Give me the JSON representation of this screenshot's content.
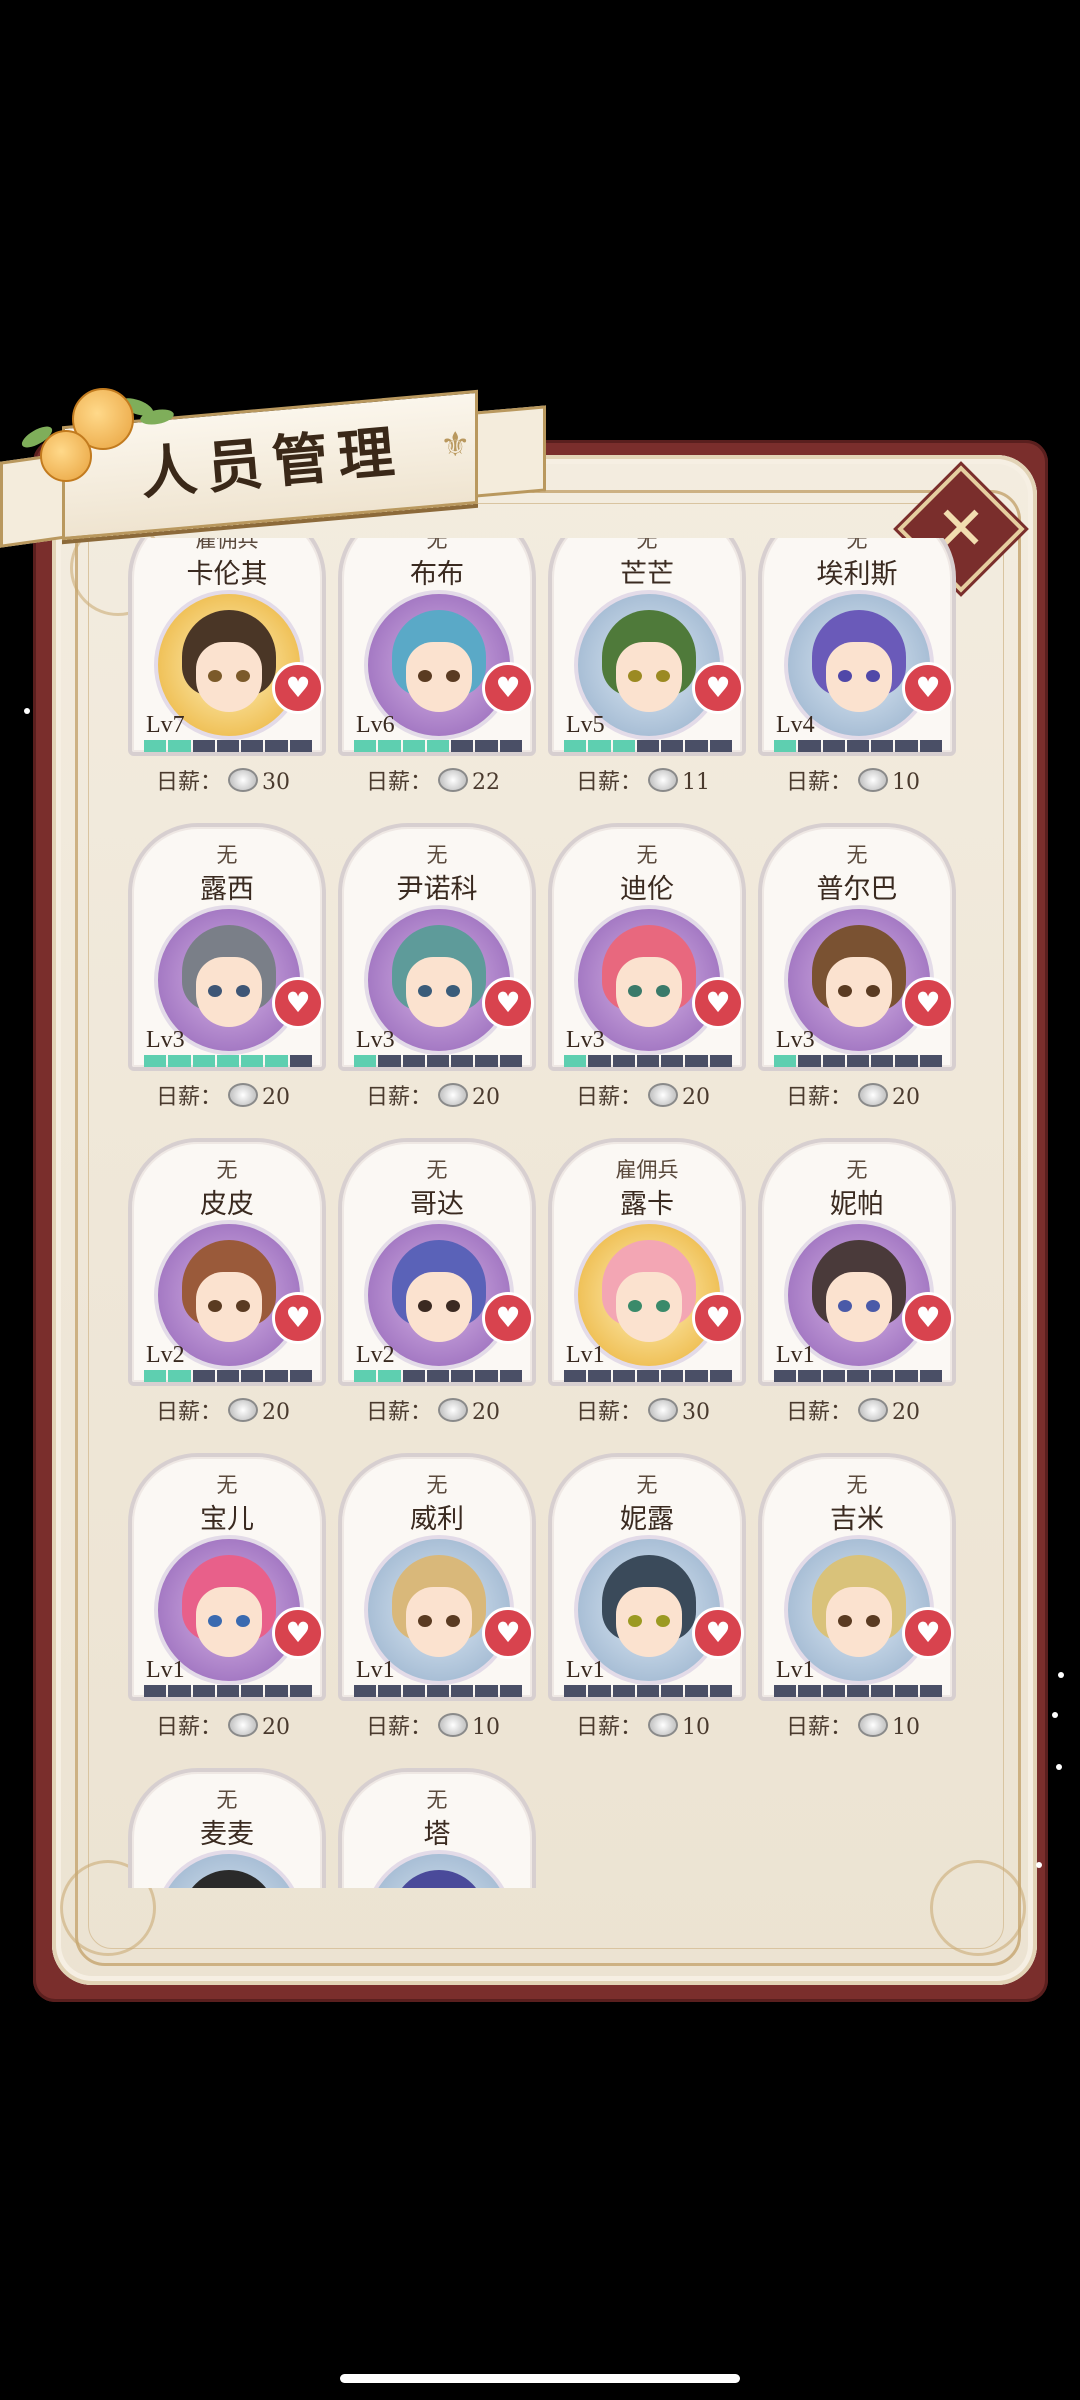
{
  "title": "人员管理",
  "salary_label": "日薪：",
  "colors": {
    "frame": "#7a2e2c",
    "heart": "#d8434e",
    "exp_bar": "#5ecfb0"
  },
  "staff": [
    {
      "role": "雇佣兵",
      "name": "卡伦其",
      "level": "Lv7",
      "exp": 2,
      "salary": "30",
      "bg": "gold",
      "hair": "#4a3626",
      "eye": "#7b5a2a"
    },
    {
      "role": "无",
      "name": "布布",
      "level": "Lv6",
      "exp": 4,
      "salary": "22",
      "bg": "purple",
      "hair": "#5aa9c7",
      "eye": "#5a3b22"
    },
    {
      "role": "无",
      "name": "芒芒",
      "level": "Lv5",
      "exp": 3,
      "salary": "11",
      "bg": "blue",
      "hair": "#4f7a3a",
      "eye": "#9b8a22"
    },
    {
      "role": "无",
      "name": "埃利斯",
      "level": "Lv4",
      "exp": 1,
      "salary": "10",
      "bg": "blue",
      "hair": "#6a5ab9",
      "eye": "#5048a8"
    },
    {
      "role": "无",
      "name": "露西",
      "level": "Lv3",
      "exp": 6,
      "salary": "20",
      "bg": "purple",
      "hair": "#7a7f88",
      "eye": "#3e5676"
    },
    {
      "role": "无",
      "name": "尹诺科",
      "level": "Lv3",
      "exp": 1,
      "salary": "20",
      "bg": "purple",
      "hair": "#5e9b9a",
      "eye": "#3a5c7a"
    },
    {
      "role": "无",
      "name": "迪伦",
      "level": "Lv3",
      "exp": 1,
      "salary": "20",
      "bg": "purple",
      "hair": "#e8687e",
      "eye": "#3a7a6a"
    },
    {
      "role": "无",
      "name": "普尔巴",
      "level": "Lv3",
      "exp": 1,
      "salary": "20",
      "bg": "purple",
      "hair": "#7a5232",
      "eye": "#5a3b22"
    },
    {
      "role": "无",
      "name": "皮皮",
      "level": "Lv2",
      "exp": 2,
      "salary": "20",
      "bg": "purple",
      "hair": "#9a5a3a",
      "eye": "#5a3b22"
    },
    {
      "role": "无",
      "name": "哥达",
      "level": "Lv2",
      "exp": 2,
      "salary": "20",
      "bg": "purple",
      "hair": "#5a62b8",
      "eye": "#3b2a22"
    },
    {
      "role": "雇佣兵",
      "name": "露卡",
      "level": "Lv1",
      "exp": 0,
      "salary": "30",
      "bg": "gold",
      "hair": "#f3a6b4",
      "eye": "#3a8a6a"
    },
    {
      "role": "无",
      "name": "妮帕",
      "level": "Lv1",
      "exp": 0,
      "salary": "20",
      "bg": "purple",
      "hair": "#4a3a3a",
      "eye": "#4a5aa8"
    },
    {
      "role": "无",
      "name": "宝儿",
      "level": "Lv1",
      "exp": 0,
      "salary": "20",
      "bg": "purple",
      "hair": "#e8608a",
      "eye": "#3a6ab0"
    },
    {
      "role": "无",
      "name": "威利",
      "level": "Lv1",
      "exp": 0,
      "salary": "10",
      "bg": "blue",
      "hair": "#d9b87a",
      "eye": "#5a3b22"
    },
    {
      "role": "无",
      "name": "妮露",
      "level": "Lv1",
      "exp": 0,
      "salary": "10",
      "bg": "blue",
      "hair": "#3a4a5a",
      "eye": "#9b9a22"
    },
    {
      "role": "无",
      "name": "吉米",
      "level": "Lv1",
      "exp": 0,
      "salary": "10",
      "bg": "blue",
      "hair": "#d9c27a",
      "eye": "#5a3b22"
    },
    {
      "role": "无",
      "name": "麦麦",
      "level": "",
      "exp": 0,
      "salary": "",
      "bg": "blue",
      "hair": "#2a2a2a",
      "eye": "#3a3a3a"
    },
    {
      "role": "无",
      "name": "塔",
      "level": "",
      "exp": 0,
      "salary": "",
      "bg": "blue",
      "hair": "#4a4a9a",
      "eye": "#3a3a3a"
    }
  ]
}
